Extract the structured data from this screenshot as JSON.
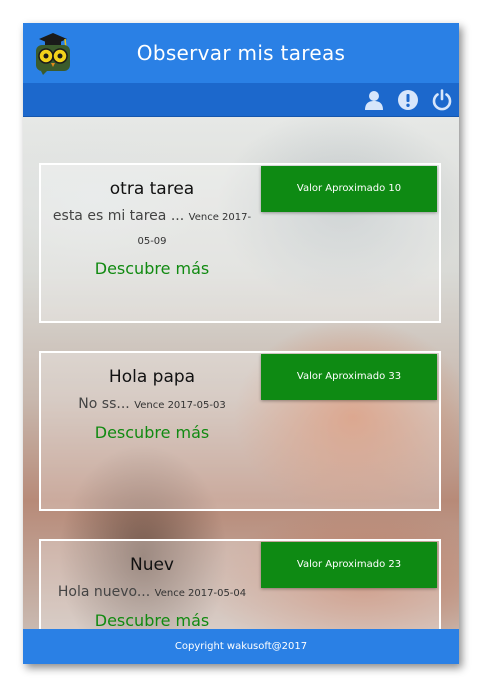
{
  "header": {
    "title": "Observar mis tareas",
    "logo_icon": "owl-graduate-icon"
  },
  "toolbar": {
    "icons": [
      "user-icon",
      "info-icon",
      "power-icon"
    ]
  },
  "tasks": [
    {
      "title": "otra tarea",
      "description": "esta es mi tarea ...",
      "due": "Vence 2017-05-09",
      "link": "Descubre más",
      "value": "Valor Aproximado 10"
    },
    {
      "title": "Hola papa",
      "description": "No ss...",
      "due": "Vence 2017-05-03",
      "link": "Descubre más",
      "value": "Valor Aproximado 33"
    },
    {
      "title": "Nuev",
      "description": "Hola nuevo...",
      "due": "Vence 2017-05-04",
      "link": "Descubre más",
      "value": "Valor Aproximado 23"
    }
  ],
  "footer": {
    "copyright": "Copyright wakusoft@2017"
  },
  "colors": {
    "topbar": "#2a80e5",
    "subbar": "#1c68cc",
    "value_button": "#0e8a13",
    "link": "#118a11"
  }
}
